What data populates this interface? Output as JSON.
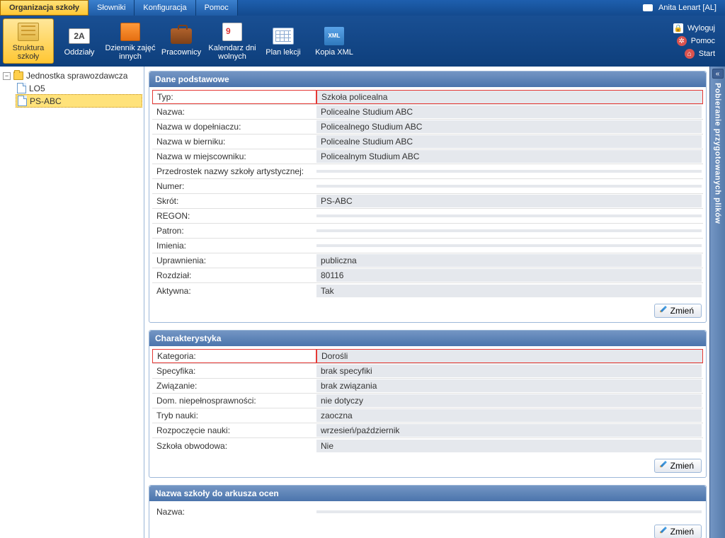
{
  "menu": {
    "tabs": [
      "Organizacja szkoły",
      "Słowniki",
      "Konfiguracja",
      "Pomoc"
    ],
    "active_index": 0
  },
  "user": {
    "name": "Anita Lenart [AL]"
  },
  "toolbar": {
    "items": [
      {
        "label": "Struktura szkoły"
      },
      {
        "label": "Oddziały",
        "badge": "2A"
      },
      {
        "label": "Dziennik zajęć innych"
      },
      {
        "label": "Pracownicy"
      },
      {
        "label": "Kalendarz dni wolnych"
      },
      {
        "label": "Plan lekcji"
      },
      {
        "label": "Kopia XML",
        "xml": "XML"
      }
    ],
    "links": {
      "logout": "Wyloguj",
      "help": "Pomoc",
      "start": "Start"
    }
  },
  "tree": {
    "root": "Jednostka sprawozdawcza",
    "children": [
      "LO5",
      "PS-ABC"
    ],
    "selected_index": 1
  },
  "panels": {
    "basic": {
      "title": "Dane podstawowe",
      "rows": [
        {
          "label": "Typ:",
          "value": "Szkoła policealna",
          "hl": true
        },
        {
          "label": "Nazwa:",
          "value": "Policealne Studium ABC"
        },
        {
          "label": "Nazwa w dopełniaczu:",
          "value": "Policealnego Studium ABC"
        },
        {
          "label": "Nazwa w bierniku:",
          "value": "Policealne Studium ABC"
        },
        {
          "label": "Nazwa w miejscowniku:",
          "value": "Policealnym Studium ABC"
        },
        {
          "label": "Przedrostek nazwy szkoły artystycznej:",
          "value": ""
        },
        {
          "label": "Numer:",
          "value": ""
        },
        {
          "label": "Skrót:",
          "value": "PS-ABC"
        },
        {
          "label": "REGON:",
          "value": ""
        },
        {
          "label": "Patron:",
          "value": ""
        },
        {
          "label": "Imienia:",
          "value": ""
        },
        {
          "label": "Uprawnienia:",
          "value": "publiczna"
        },
        {
          "label": "Rozdział:",
          "value": "80116"
        },
        {
          "label": "Aktywna:",
          "value": "Tak"
        }
      ],
      "edit": "Zmień"
    },
    "char": {
      "title": "Charakterystyka",
      "rows": [
        {
          "label": "Kategoria:",
          "value": "Dorośli",
          "hl": true
        },
        {
          "label": "Specyfika:",
          "value": "brak specyfiki"
        },
        {
          "label": "Związanie:",
          "value": "brak związania"
        },
        {
          "label": "Dom. niepełnosprawności:",
          "value": "nie dotyczy"
        },
        {
          "label": "Tryb nauki:",
          "value": "zaoczna"
        },
        {
          "label": "Rozpoczęcie nauki:",
          "value": "wrzesień/październik"
        },
        {
          "label": "Szkoła obwodowa:",
          "value": "Nie"
        }
      ],
      "edit": "Zmień"
    },
    "sheet": {
      "title": "Nazwa szkoły do arkusza ocen",
      "rows": [
        {
          "label": "Nazwa:",
          "value": ""
        }
      ],
      "edit": "Zmień"
    }
  },
  "side": {
    "label": "Pobieranie przygotowanych plików",
    "arrow": "«"
  }
}
